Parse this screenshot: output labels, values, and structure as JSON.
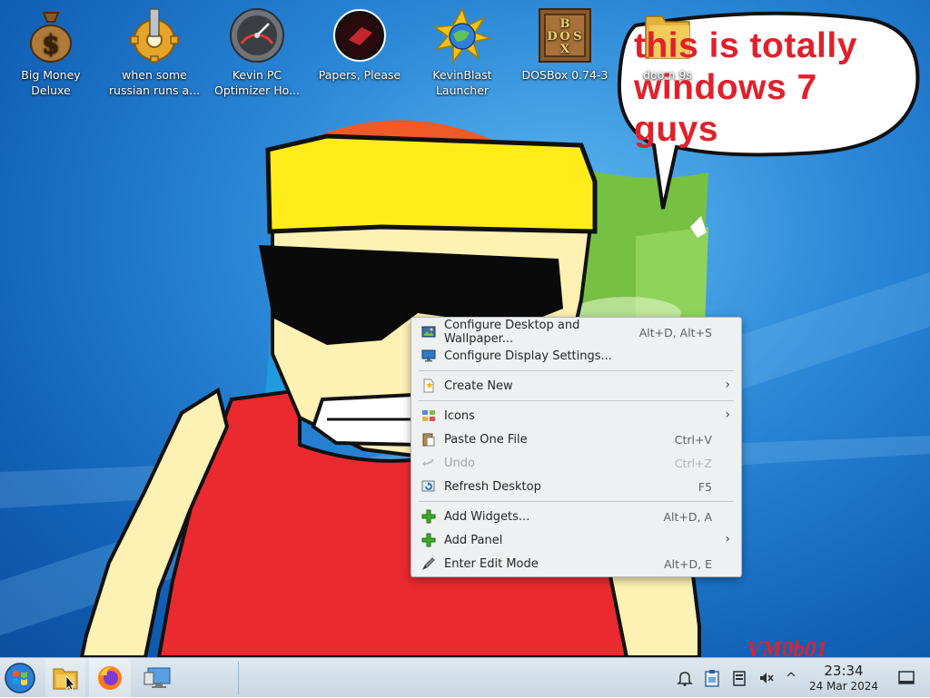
{
  "desktop": {
    "icons": [
      {
        "label": "Big Money\nDeluxe",
        "icon": "money-bag-icon"
      },
      {
        "label": "when some\nrussian runs a...",
        "icon": "gear-icon"
      },
      {
        "label": "Kevin PC\nOptimizer Ho...",
        "icon": "speedometer-icon"
      },
      {
        "label": "Papers, Please",
        "icon": "papers-please-icon"
      },
      {
        "label": "KevinBlast\nLauncher",
        "icon": "globe-star-icon"
      },
      {
        "label": "DOSBox 0.74-3",
        "icon": "dosbox-icon"
      },
      {
        "label": "doom 9s",
        "icon": "folder-icon"
      }
    ],
    "speech_bubble_text": "this is totally\nwindows 7 guys",
    "watermark_text": "VM0b01"
  },
  "context_menu": {
    "items": [
      {
        "label": "Configure Desktop and Wallpaper...",
        "shortcut": "Alt+D, Alt+S",
        "icon": "wallpaper-settings-icon",
        "enabled": true,
        "submenu": false
      },
      {
        "label": "Configure Display Settings...",
        "shortcut": "",
        "icon": "display-icon",
        "enabled": true,
        "submenu": false
      },
      {
        "label": "Create New",
        "shortcut": "",
        "icon": "new-document-icon",
        "enabled": true,
        "submenu": true
      },
      {
        "label": "Icons",
        "shortcut": "",
        "icon": "icons-view-icon",
        "enabled": true,
        "submenu": true
      },
      {
        "label": "Paste One File",
        "shortcut": "Ctrl+V",
        "icon": "paste-icon",
        "enabled": true,
        "submenu": false
      },
      {
        "label": "Undo",
        "shortcut": "Ctrl+Z",
        "icon": "undo-icon",
        "enabled": false,
        "submenu": false
      },
      {
        "label": "Refresh Desktop",
        "shortcut": "F5",
        "icon": "refresh-icon",
        "enabled": true,
        "submenu": false
      },
      {
        "label": "Add Widgets...",
        "shortcut": "Alt+D, A",
        "icon": "add-icon",
        "enabled": true,
        "submenu": false
      },
      {
        "label": "Add Panel",
        "shortcut": "",
        "icon": "add-icon",
        "enabled": true,
        "submenu": true
      },
      {
        "label": "Enter Edit Mode",
        "shortcut": "Alt+D, E",
        "icon": "edit-mode-icon",
        "enabled": true,
        "submenu": false
      }
    ],
    "submenu_arrow": "›"
  },
  "taskbar": {
    "clock_time": "23:34",
    "clock_date": "24 Mar 2024",
    "tray_expand_glyph": "^"
  },
  "colors": {
    "speech_text": "#e0212b",
    "menu_background": "#eff0f1",
    "taskbar_background": "#d4dfe9",
    "desktop_blue": "#2a86d6"
  }
}
